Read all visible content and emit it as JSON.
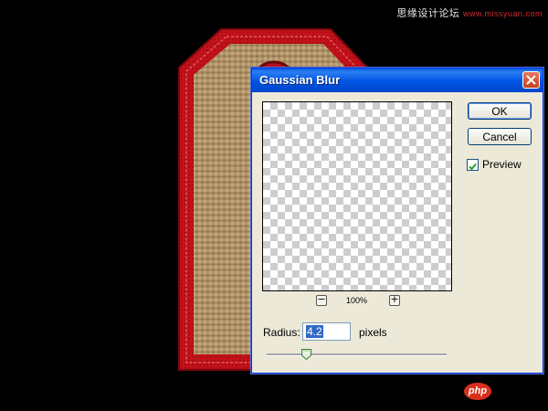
{
  "watermark": {
    "brand": "思缘设计论坛",
    "url": "www.missyuan.com"
  },
  "dialog": {
    "title": "Gaussian Blur",
    "ok_label": "OK",
    "cancel_label": "Cancel",
    "preview_label": "Preview",
    "preview_checked": true,
    "zoom_minus": "−",
    "zoom_plus": "+",
    "zoom_level": "100%",
    "radius_label": "Radius:",
    "radius_value": "4.2",
    "radius_unit": "pixels",
    "slider_fraction": 0.22
  },
  "logo": {
    "text": "php"
  },
  "colors": {
    "tag_red": "#c8141c",
    "burlap": "#a88a5c",
    "titlebar_blue": "#0054e3",
    "dialog_bg": "#ece9d8"
  }
}
